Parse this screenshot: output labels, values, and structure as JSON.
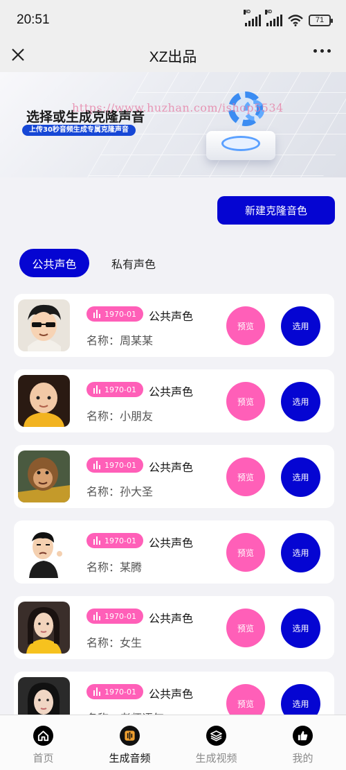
{
  "status_bar": {
    "time": "20:51",
    "signal_label_1": "HD",
    "signal_label_2": "HD",
    "battery": "71"
  },
  "nav": {
    "title": "XZ出品",
    "close_icon": "close-icon",
    "more_icon": "more-icon"
  },
  "banner": {
    "title": "选择或生成克隆声音",
    "subtitle": "上传30秒音频生成专属克隆声音",
    "watermark": "https://www.huzhan.com/ishop5534"
  },
  "actions": {
    "new_clone_label": "新建克隆音色"
  },
  "tabs": [
    {
      "label": "公共声色",
      "active": true
    },
    {
      "label": "私有声色",
      "active": false
    }
  ],
  "voices": [
    {
      "badge": "1970-01",
      "type": "公共声色",
      "name": "名称：周某某",
      "preview": "预览",
      "select": "选用",
      "avatar": "avatar-cartoon-sunglasses"
    },
    {
      "badge": "1970-01",
      "type": "公共声色",
      "name": "名称：小朋友",
      "preview": "预览",
      "select": "选用",
      "avatar": "avatar-child"
    },
    {
      "badge": "1970-01",
      "type": "公共声色",
      "name": "名称：孙大圣",
      "preview": "预览",
      "select": "选用",
      "avatar": "avatar-monkey-king"
    },
    {
      "badge": "1970-01",
      "type": "公共声色",
      "name": "名称：某腾",
      "preview": "预览",
      "select": "选用",
      "avatar": "avatar-cartoon-man"
    },
    {
      "badge": "1970-01",
      "type": "公共声色",
      "name": "名称：女生",
      "preview": "预览",
      "select": "选用",
      "avatar": "avatar-woman"
    },
    {
      "badge": "1970-01",
      "type": "公共声色",
      "name": "名称：老师语气",
      "preview": "预览",
      "select": "选用",
      "avatar": "avatar-teacher"
    }
  ],
  "tabbar": [
    {
      "label": "首页",
      "icon": "home-icon",
      "active": false
    },
    {
      "label": "生成音频",
      "icon": "audio-icon",
      "active": true
    },
    {
      "label": "生成视频",
      "icon": "layers-icon",
      "active": false
    },
    {
      "label": "我的",
      "icon": "thumbs-up-icon",
      "active": false
    }
  ],
  "colors": {
    "primary": "#0505d2",
    "accent_pink": "#ff5fb8",
    "background": "#f2f2f6"
  }
}
